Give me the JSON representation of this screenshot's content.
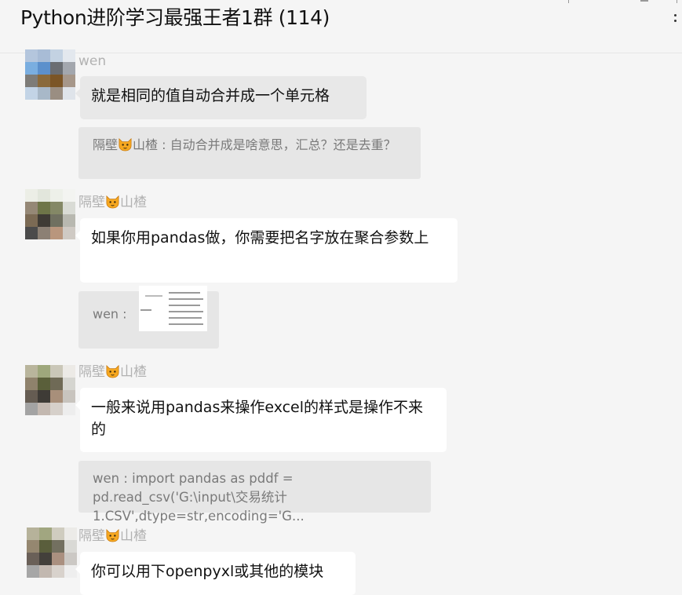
{
  "header": {
    "title": "Python进阶学习最强王者1群 (114)"
  },
  "icons": {
    "cat_emoji": "cat-face-emoji",
    "more": "more-icon"
  },
  "messages": [
    {
      "sender": "wen",
      "text": "就是相同的值自动合并成一个单元格"
    },
    {
      "quote_prefix": "隔壁",
      "quote_suffix": "山楂 : 自动合并成是啥意思，汇总？还是去重？"
    },
    {
      "sender_prefix": "隔壁",
      "sender_suffix": "山楂",
      "text": "如果你用pandas做，你需要把名字放在聚合参数上"
    },
    {
      "quote_text": "wen : "
    },
    {
      "sender_prefix": "隔壁",
      "sender_suffix": "山楂",
      "text": "一般来说用pandas来操作excel的样式是操作不来的"
    },
    {
      "quote_text": "wen : import pandas as pddf = pd.read_csv('G:\\input\\交易统计1.CSV',dtype=str,encoding='G..."
    },
    {
      "sender_prefix": "隔壁",
      "sender_suffix": "山楂",
      "text": "你可以用下openpyxl或其他的模块"
    }
  ],
  "colors": {
    "background": "#f5f5f5",
    "bubble": "#ffffff",
    "quote": "#e6e6e6",
    "sender_name": "#b2b2b2"
  }
}
